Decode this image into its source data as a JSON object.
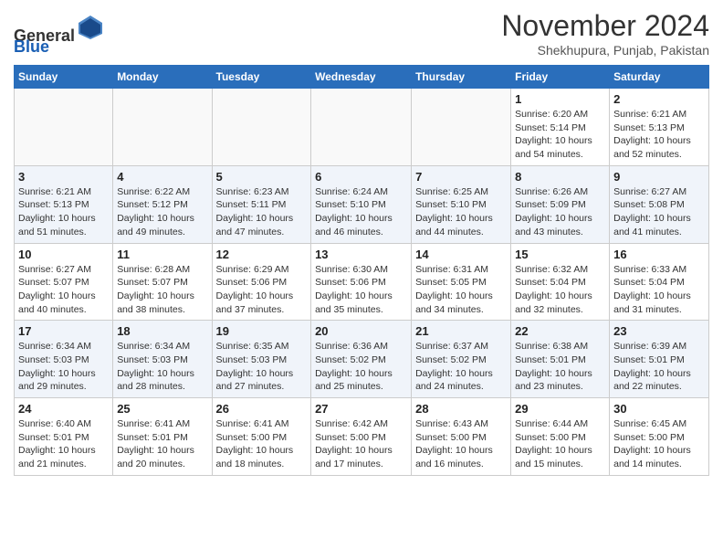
{
  "header": {
    "logo_general": "General",
    "logo_blue": "Blue",
    "month_title": "November 2024",
    "location": "Shekhupura, Punjab, Pakistan"
  },
  "days_of_week": [
    "Sunday",
    "Monday",
    "Tuesday",
    "Wednesday",
    "Thursday",
    "Friday",
    "Saturday"
  ],
  "weeks": [
    [
      {
        "date": "",
        "info": ""
      },
      {
        "date": "",
        "info": ""
      },
      {
        "date": "",
        "info": ""
      },
      {
        "date": "",
        "info": ""
      },
      {
        "date": "",
        "info": ""
      },
      {
        "date": "1",
        "info": "Sunrise: 6:20 AM\nSunset: 5:14 PM\nDaylight: 10 hours and 54 minutes."
      },
      {
        "date": "2",
        "info": "Sunrise: 6:21 AM\nSunset: 5:13 PM\nDaylight: 10 hours and 52 minutes."
      }
    ],
    [
      {
        "date": "3",
        "info": "Sunrise: 6:21 AM\nSunset: 5:13 PM\nDaylight: 10 hours and 51 minutes."
      },
      {
        "date": "4",
        "info": "Sunrise: 6:22 AM\nSunset: 5:12 PM\nDaylight: 10 hours and 49 minutes."
      },
      {
        "date": "5",
        "info": "Sunrise: 6:23 AM\nSunset: 5:11 PM\nDaylight: 10 hours and 47 minutes."
      },
      {
        "date": "6",
        "info": "Sunrise: 6:24 AM\nSunset: 5:10 PM\nDaylight: 10 hours and 46 minutes."
      },
      {
        "date": "7",
        "info": "Sunrise: 6:25 AM\nSunset: 5:10 PM\nDaylight: 10 hours and 44 minutes."
      },
      {
        "date": "8",
        "info": "Sunrise: 6:26 AM\nSunset: 5:09 PM\nDaylight: 10 hours and 43 minutes."
      },
      {
        "date": "9",
        "info": "Sunrise: 6:27 AM\nSunset: 5:08 PM\nDaylight: 10 hours and 41 minutes."
      }
    ],
    [
      {
        "date": "10",
        "info": "Sunrise: 6:27 AM\nSunset: 5:07 PM\nDaylight: 10 hours and 40 minutes."
      },
      {
        "date": "11",
        "info": "Sunrise: 6:28 AM\nSunset: 5:07 PM\nDaylight: 10 hours and 38 minutes."
      },
      {
        "date": "12",
        "info": "Sunrise: 6:29 AM\nSunset: 5:06 PM\nDaylight: 10 hours and 37 minutes."
      },
      {
        "date": "13",
        "info": "Sunrise: 6:30 AM\nSunset: 5:06 PM\nDaylight: 10 hours and 35 minutes."
      },
      {
        "date": "14",
        "info": "Sunrise: 6:31 AM\nSunset: 5:05 PM\nDaylight: 10 hours and 34 minutes."
      },
      {
        "date": "15",
        "info": "Sunrise: 6:32 AM\nSunset: 5:04 PM\nDaylight: 10 hours and 32 minutes."
      },
      {
        "date": "16",
        "info": "Sunrise: 6:33 AM\nSunset: 5:04 PM\nDaylight: 10 hours and 31 minutes."
      }
    ],
    [
      {
        "date": "17",
        "info": "Sunrise: 6:34 AM\nSunset: 5:03 PM\nDaylight: 10 hours and 29 minutes."
      },
      {
        "date": "18",
        "info": "Sunrise: 6:34 AM\nSunset: 5:03 PM\nDaylight: 10 hours and 28 minutes."
      },
      {
        "date": "19",
        "info": "Sunrise: 6:35 AM\nSunset: 5:03 PM\nDaylight: 10 hours and 27 minutes."
      },
      {
        "date": "20",
        "info": "Sunrise: 6:36 AM\nSunset: 5:02 PM\nDaylight: 10 hours and 25 minutes."
      },
      {
        "date": "21",
        "info": "Sunrise: 6:37 AM\nSunset: 5:02 PM\nDaylight: 10 hours and 24 minutes."
      },
      {
        "date": "22",
        "info": "Sunrise: 6:38 AM\nSunset: 5:01 PM\nDaylight: 10 hours and 23 minutes."
      },
      {
        "date": "23",
        "info": "Sunrise: 6:39 AM\nSunset: 5:01 PM\nDaylight: 10 hours and 22 minutes."
      }
    ],
    [
      {
        "date": "24",
        "info": "Sunrise: 6:40 AM\nSunset: 5:01 PM\nDaylight: 10 hours and 21 minutes."
      },
      {
        "date": "25",
        "info": "Sunrise: 6:41 AM\nSunset: 5:01 PM\nDaylight: 10 hours and 20 minutes."
      },
      {
        "date": "26",
        "info": "Sunrise: 6:41 AM\nSunset: 5:00 PM\nDaylight: 10 hours and 18 minutes."
      },
      {
        "date": "27",
        "info": "Sunrise: 6:42 AM\nSunset: 5:00 PM\nDaylight: 10 hours and 17 minutes."
      },
      {
        "date": "28",
        "info": "Sunrise: 6:43 AM\nSunset: 5:00 PM\nDaylight: 10 hours and 16 minutes."
      },
      {
        "date": "29",
        "info": "Sunrise: 6:44 AM\nSunset: 5:00 PM\nDaylight: 10 hours and 15 minutes."
      },
      {
        "date": "30",
        "info": "Sunrise: 6:45 AM\nSunset: 5:00 PM\nDaylight: 10 hours and 14 minutes."
      }
    ]
  ]
}
